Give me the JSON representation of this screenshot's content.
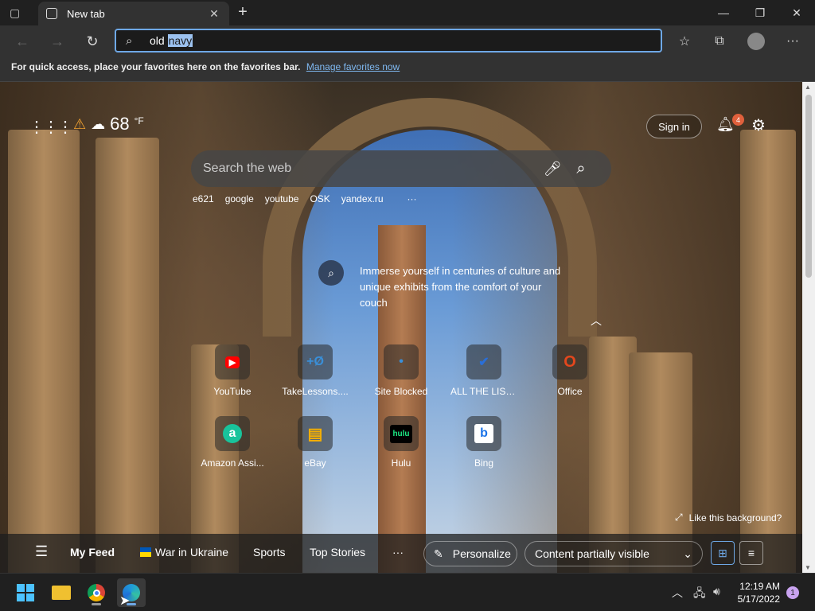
{
  "browser": {
    "tab_title": "New tab",
    "address_typed": "old ",
    "address_selected": "navy",
    "favbar_message": "For quick access, place your favorites here on the favorites bar.",
    "favbar_link": "Manage favorites now"
  },
  "newtab": {
    "weather_temp": "68",
    "weather_unit": "°F",
    "signin_label": "Sign in",
    "notification_count": "4",
    "search_placeholder": "Search the web",
    "quick_links": [
      "e621",
      "google",
      "youtube",
      "OSK",
      "yandex.ru"
    ],
    "promo_text": "Immerse yourself in centuries of culture and unique exhibits from the comfort of your couch",
    "tiles": [
      {
        "label": "YouTube",
        "glyph": "▶",
        "color": "#ff0000"
      },
      {
        "label": "TakeLessons....",
        "glyph": "+Ø",
        "color": "#3a8fd8"
      },
      {
        "label": "Site Blocked",
        "glyph": "•",
        "color": "#3a8fd8"
      },
      {
        "label": "ALL THE LIST...",
        "glyph": "✔",
        "color": "#2a6fd8"
      },
      {
        "label": "Office",
        "glyph": "O",
        "color": "#e3471d"
      },
      {
        "label": "Amazon Assi...",
        "glyph": "a",
        "color": "#19c39b"
      },
      {
        "label": "eBay",
        "glyph": "▤",
        "color": "#e53238"
      },
      {
        "label": "Hulu",
        "glyph": "hulu",
        "color": "#1ce783"
      },
      {
        "label": "Bing",
        "glyph": "b",
        "color": "#1a73e8"
      }
    ],
    "like_background": "Like this background?",
    "feed": {
      "my_feed": "My Feed",
      "war_in_ukraine": "War in Ukraine",
      "sports": "Sports",
      "top_stories": "Top Stories",
      "more": "···",
      "personalize": "Personalize",
      "content_visibility": "Content partially visible"
    }
  },
  "taskbar": {
    "time": "12:19 AM",
    "date": "5/17/2022",
    "notifications": "1"
  }
}
